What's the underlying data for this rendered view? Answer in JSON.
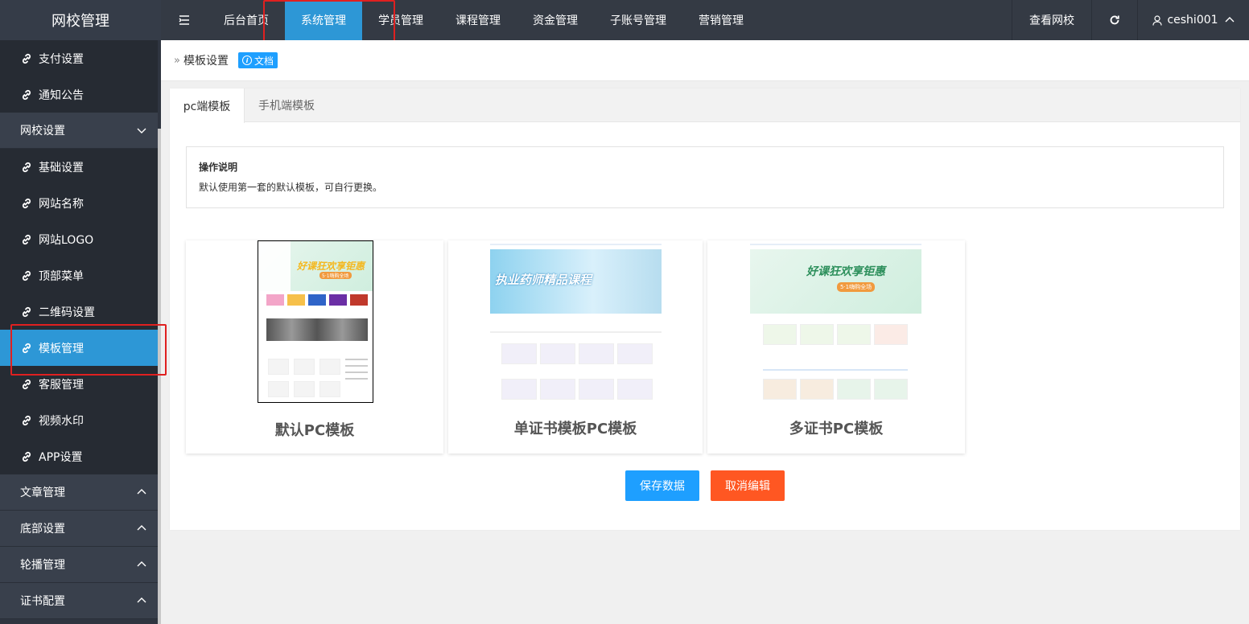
{
  "app": {
    "title": "网校管理"
  },
  "topnav": {
    "items": [
      "后台首页",
      "系统管理",
      "学员管理",
      "课程管理",
      "资金管理",
      "子账号管理",
      "营销管理"
    ],
    "active": "系统管理",
    "view_site": "查看网校",
    "username": "ceshi001"
  },
  "sidebar": {
    "top_items": [
      "支付设置",
      "通知公告"
    ],
    "group": "网校设置",
    "group_items": [
      "基础设置",
      "网站名称",
      "网站LOGO",
      "顶部菜单",
      "二维码设置",
      "模板管理",
      "客服管理",
      "视频水印",
      "APP设置"
    ],
    "active": "模板管理",
    "collapsed_groups": [
      "文章管理",
      "底部设置",
      "轮播管理",
      "证书配置"
    ]
  },
  "breadcrumb": {
    "label": "模板设置",
    "doc": "文档"
  },
  "tabs": [
    "pc端模板",
    "手机端模板"
  ],
  "notice": {
    "title": "操作说明",
    "text": "默认使用第一套的默认模板，可自行更换。"
  },
  "templates": [
    {
      "name": "默认PC模板",
      "banner": "好课狂欢享钜惠",
      "sub": "5·1嗨购全场"
    },
    {
      "name": "单证书模板PC模板",
      "banner": "执业药师精品课程"
    },
    {
      "name": "多证书PC模板",
      "banner": "好课狂欢享钜惠",
      "sub": "5·1嗨购全场"
    }
  ],
  "buttons": {
    "save": "保存数据",
    "cancel": "取消编辑"
  },
  "colors": {
    "sidebar": "#2f3540",
    "active": "#2d97d6",
    "primary": "#1e9fff",
    "danger": "#ff5722",
    "highlight": "#e02020"
  }
}
